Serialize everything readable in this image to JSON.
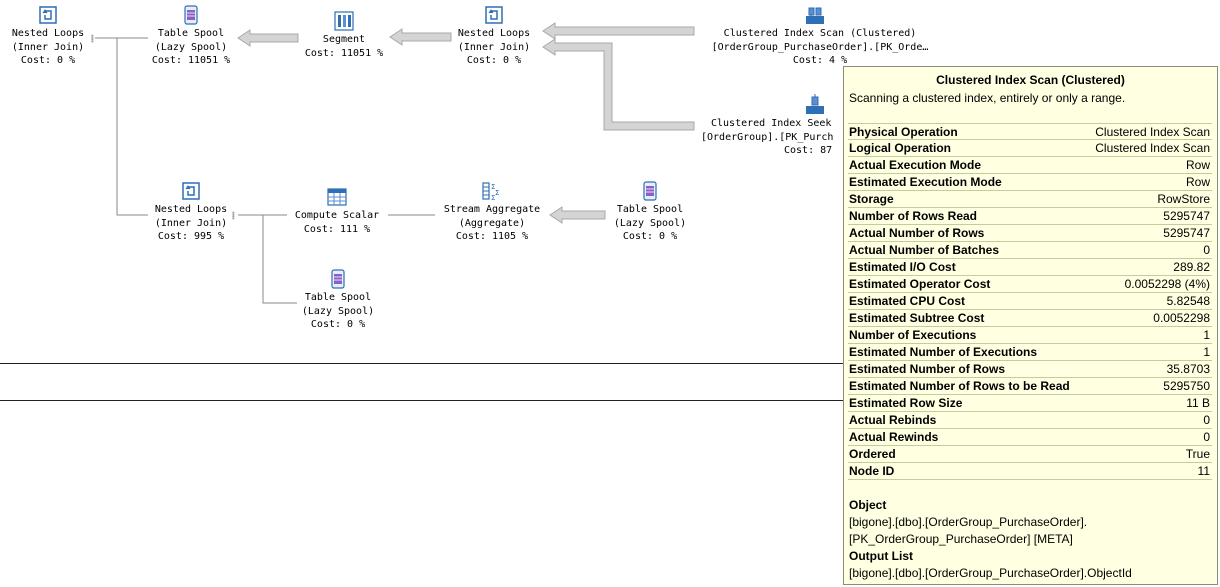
{
  "nodes": {
    "nested_loops_1": {
      "op": "Nested Loops",
      "detail": "(Inner Join)",
      "cost": "Cost: 0 %",
      "icon": "nested-loops-icon"
    },
    "table_spool_1": {
      "op": "Table Spool",
      "detail": "(Lazy Spool)",
      "cost": "Cost: 11051 %",
      "icon": "table-spool-icon"
    },
    "segment": {
      "op": "Segment",
      "cost": "Cost: 11051 %",
      "icon": "segment-icon"
    },
    "nested_loops_2": {
      "op": "Nested Loops",
      "detail": "(Inner Join)",
      "cost": "Cost: 0 %",
      "icon": "nested-loops-icon"
    },
    "clustered_scan": {
      "op": "Clustered Index Scan (Clustered)",
      "detail": "[OrderGroup_PurchaseOrder].[PK_Orde…",
      "cost": "Cost: 4 %",
      "icon": "clustered-index-scan-icon"
    },
    "clustered_seek": {
      "op": "Clustered Index Seek",
      "detail": "[OrderGroup].[PK_Purch",
      "cost": "Cost: 87",
      "icon": "clustered-index-seek-icon"
    },
    "nested_loops_3": {
      "op": "Nested Loops",
      "detail": "(Inner Join)",
      "cost": "Cost: 995 %",
      "icon": "nested-loops-icon"
    },
    "compute_scalar": {
      "op": "Compute Scalar",
      "cost": "Cost: 111 %",
      "icon": "compute-scalar-icon"
    },
    "stream_aggregate": {
      "op": "Stream Aggregate",
      "detail": "(Aggregate)",
      "cost": "Cost: 1105 %",
      "icon": "stream-aggregate-icon"
    },
    "table_spool_2": {
      "op": "Table Spool",
      "detail": "(Lazy Spool)",
      "cost": "Cost: 0 %",
      "icon": "table-spool-icon"
    },
    "table_spool_3": {
      "op": "Table Spool",
      "detail": "(Lazy Spool)",
      "cost": "Cost: 0 %",
      "icon": "table-spool-icon"
    }
  },
  "tooltip": {
    "title": "Clustered Index Scan (Clustered)",
    "description": "Scanning a clustered index, entirely or only a range.",
    "properties": [
      {
        "name": "Physical Operation",
        "value": "Clustered Index Scan"
      },
      {
        "name": "Logical Operation",
        "value": "Clustered Index Scan"
      },
      {
        "name": "Actual Execution Mode",
        "value": "Row"
      },
      {
        "name": "Estimated Execution Mode",
        "value": "Row"
      },
      {
        "name": "Storage",
        "value": "RowStore"
      },
      {
        "name": "Number of Rows Read",
        "value": "5295747"
      },
      {
        "name": "Actual Number of Rows",
        "value": "5295747"
      },
      {
        "name": "Actual Number of Batches",
        "value": "0"
      },
      {
        "name": "Estimated I/O Cost",
        "value": "289.82"
      },
      {
        "name": "Estimated Operator Cost",
        "value": "0.0052298 (4%)"
      },
      {
        "name": "Estimated CPU Cost",
        "value": "5.82548"
      },
      {
        "name": "Estimated Subtree Cost",
        "value": "0.0052298"
      },
      {
        "name": "Number of Executions",
        "value": "1"
      },
      {
        "name": "Estimated Number of Executions",
        "value": "1"
      },
      {
        "name": "Estimated Number of Rows",
        "value": "35.8703"
      },
      {
        "name": "Estimated Number of Rows to be Read",
        "value": "5295750"
      },
      {
        "name": "Estimated Row Size",
        "value": "11 B"
      },
      {
        "name": "Actual Rebinds",
        "value": "0"
      },
      {
        "name": "Actual Rewinds",
        "value": "0"
      },
      {
        "name": "Ordered",
        "value": "True"
      },
      {
        "name": "Node ID",
        "value": "11"
      }
    ],
    "object_title": "Object",
    "object_lines": [
      "[bigone].[dbo].[OrderGroup_PurchaseOrder].",
      "[PK_OrderGroup_PurchaseOrder] [META]"
    ],
    "output_title": "Output List",
    "output_lines": [
      "[bigone].[dbo].[OrderGroup_PurchaseOrder].ObjectId"
    ]
  },
  "colors": {
    "tooltip_bg": "#ffffe1",
    "tooltip_border": "#8c8c78",
    "arrow_fill": "#d4d4d4",
    "arrow_stroke": "#a8a8a8",
    "icon_blue": "#2e6fb5"
  }
}
